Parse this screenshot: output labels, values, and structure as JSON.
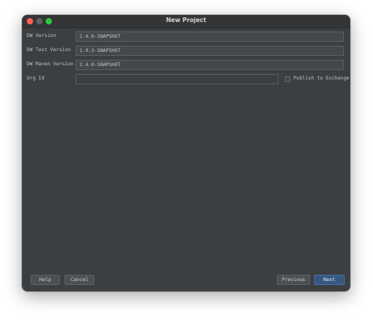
{
  "window": {
    "title": "New Project"
  },
  "form": {
    "dw_version": {
      "label": "DW Version",
      "value": "2.4.0-SNAPSHOT"
    },
    "dw_test_version": {
      "label": "DW Test Version",
      "value": "1.0.3-SNAPSHOT"
    },
    "dw_maven_version": {
      "label": "DW Maven Version",
      "value": "2.4.0-SNAPSHOT"
    },
    "org_id": {
      "label": "Org Id",
      "value": ""
    },
    "publish": {
      "label": "Publish to Exchange",
      "checked": false
    }
  },
  "buttons": {
    "help": "Help",
    "cancel": "Cancel",
    "previous": "Previous",
    "next": "Next"
  },
  "colors": {
    "window_bg": "#3c3f41",
    "primary_button": "#365880",
    "close": "#fe5f57",
    "maximize": "#27c93f"
  }
}
